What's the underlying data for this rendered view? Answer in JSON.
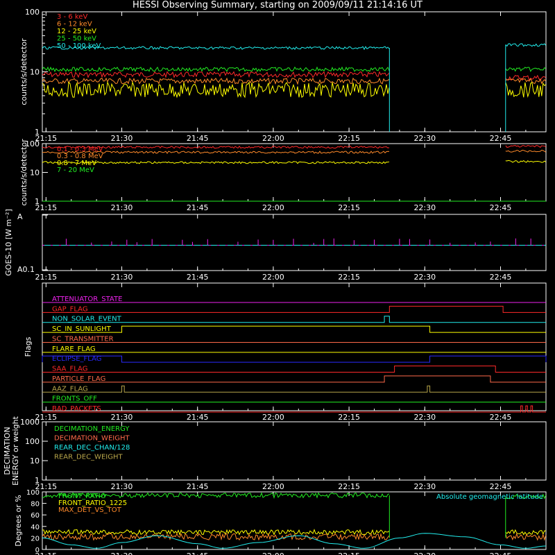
{
  "title": "HESSI Observing Summary, starting on 2009/09/11 21:14:16 UT",
  "colors": {
    "white": "#ffffff",
    "red": "#ff2a2a",
    "orange": "#ff8a2a",
    "yellow": "#ffff00",
    "green": "#22ee22",
    "cyan": "#22eeee",
    "magenta": "#ee22ee",
    "blue": "#2a2aff",
    "olive": "#b8a64a",
    "salmon": "#ff6a4a"
  },
  "time_ticks": [
    "21:15",
    "21:30",
    "21:45",
    "22:00",
    "22:15",
    "22:30",
    "22:45"
  ],
  "time_axis": {
    "start": "21:14:16",
    "end": "22:54:00"
  },
  "chart_data": [
    {
      "id": "panel1",
      "type": "line",
      "ylabel": "counts/s/detector",
      "yscale": "log",
      "ylim": [
        1,
        100
      ],
      "yticks": [
        "1",
        "10",
        "100"
      ],
      "legend_position": "top-left",
      "series": [
        {
          "name": "3 - 6 keV",
          "color": "red",
          "segments": [
            {
              "t0": "21:14:16",
              "t1": "22:23:00",
              "level": 9
            },
            {
              "t0": "22:46:00",
              "t1": "22:54:00",
              "level": 8
            }
          ]
        },
        {
          "name": "6 - 12 keV",
          "color": "orange",
          "segments": [
            {
              "t0": "21:14:16",
              "t1": "22:23:00",
              "level": 7
            },
            {
              "t0": "22:46:00",
              "t1": "22:54:00",
              "level": 7
            }
          ]
        },
        {
          "name": "12 - 25 keV",
          "color": "yellow",
          "segments": [
            {
              "t0": "21:14:16",
              "t1": "22:23:00",
              "level": 5
            },
            {
              "t0": "22:46:00",
              "t1": "22:54:00",
              "level": 5
            }
          ]
        },
        {
          "name": "25 - 50 keV",
          "color": "green",
          "segments": [
            {
              "t0": "21:14:16",
              "t1": "22:23:00",
              "level": 11
            },
            {
              "t0": "22:46:00",
              "t1": "22:54:00",
              "level": 11
            }
          ]
        },
        {
          "name": "50 - 100 keV",
          "color": "cyan",
          "segments": [
            {
              "t0": "21:14:16",
              "t1": "22:23:00",
              "level": 25
            },
            {
              "t0": "22:46:00",
              "t1": "22:54:00",
              "level": 28
            }
          ]
        }
      ]
    },
    {
      "id": "panel2",
      "type": "line",
      "ylabel": "counts/s/detector",
      "yscale": "log",
      "ylim": [
        1,
        100
      ],
      "yticks": [
        "1",
        "10",
        "100"
      ],
      "legend_position": "top-left",
      "series": [
        {
          "name": "0.1 - 0.3 MeV",
          "color": "red",
          "segments": [
            {
              "t0": "21:14:16",
              "t1": "22:23:00",
              "level": 75
            },
            {
              "t0": "22:46:00",
              "t1": "22:54:00",
              "level": 80
            }
          ]
        },
        {
          "name": "0.3 - 0.8 MeV",
          "color": "orange",
          "segments": [
            {
              "t0": "21:14:16",
              "t1": "22:23:00",
              "level": 50
            },
            {
              "t0": "22:46:00",
              "t1": "22:54:00",
              "level": 55
            }
          ]
        },
        {
          "name": "0.8 - 7 MeV",
          "color": "yellow",
          "segments": [
            {
              "t0": "21:14:16",
              "t1": "22:23:00",
              "level": 22
            },
            {
              "t0": "22:46:00",
              "t1": "22:54:00",
              "level": 24
            }
          ]
        },
        {
          "name": "7 - 20 MeV",
          "color": "green",
          "segments": [
            {
              "t0": "21:14:16",
              "t1": "22:54:00",
              "level": 1
            }
          ]
        }
      ]
    },
    {
      "id": "panel3",
      "type": "line",
      "ylabel": "GOES-10 [W m⁻²]",
      "yticks": [
        "A",
        "A0.1"
      ],
      "series": [
        {
          "name": "",
          "color": "magenta",
          "baseline_frac": 0.55,
          "spike_times": [
            "21:19",
            "21:24",
            "21:28",
            "21:31",
            "21:33",
            "21:36",
            "21:42",
            "21:44",
            "21:47",
            "21:53",
            "21:57",
            "22:00",
            "22:04",
            "22:08",
            "22:10",
            "22:12",
            "22:16",
            "22:20",
            "22:25",
            "22:27",
            "22:31",
            "22:35",
            "22:40",
            "22:43",
            "22:48",
            "22:51"
          ]
        }
      ]
    },
    {
      "id": "panel4",
      "type": "line",
      "ylabel": "Flags",
      "flags": [
        {
          "name": "ATTENUATOR_STATE",
          "color": "magenta",
          "on": []
        },
        {
          "name": "GAP_FLAG",
          "color": "red",
          "on": [
            [
              "22:23:00",
              "22:45:30"
            ]
          ]
        },
        {
          "name": "NON_SOLAR_EVENT",
          "color": "cyan",
          "on": [
            [
              "22:22:00",
              "22:23:00"
            ]
          ]
        },
        {
          "name": "SC_IN_SUNLIGHT",
          "color": "yellow",
          "on": [
            [
              "21:30:00",
              "22:31:00"
            ]
          ]
        },
        {
          "name": "SC_TRANSMITTER",
          "color": "salmon",
          "on": []
        },
        {
          "name": "FLARE_FLAG",
          "color": "yellow",
          "on": []
        },
        {
          "name": "ECLIPSE_FLAG",
          "color": "blue",
          "on": [
            [
              "21:14:16",
              "21:30:00"
            ],
            [
              "22:31:00",
              "22:54:00"
            ]
          ]
        },
        {
          "name": "SAA_FLAG",
          "color": "red",
          "on": [
            [
              "22:24:00",
              "22:44:00"
            ]
          ]
        },
        {
          "name": "PARTICLE_FLAG",
          "color": "salmon",
          "on": [
            [
              "22:22:00",
              "22:43:00"
            ]
          ]
        },
        {
          "name": "AAZ_FLAG",
          "color": "olive",
          "on": [
            [
              "21:30:00",
              "21:30:30"
            ],
            [
              "22:30:30",
              "22:31:00"
            ]
          ]
        },
        {
          "name": "FRONTS_OFF",
          "color": "green",
          "on": []
        },
        {
          "name": "BAD_PACKETS",
          "color": "red",
          "on": [
            [
              "22:49:00",
              "22:49:20"
            ],
            [
              "22:50:00",
              "22:50:20"
            ],
            [
              "22:51:00",
              "22:51:20"
            ]
          ]
        }
      ]
    },
    {
      "id": "panel5",
      "type": "line",
      "ylabel": "DECIMATION ENERGY or weight",
      "yscale": "log",
      "ylim": [
        1,
        1000
      ],
      "yticks": [
        "1",
        "10",
        "100",
        "1000"
      ],
      "legend_position": "top-left",
      "series": [
        {
          "name": "DECIMATION_ENERGY",
          "color": "green",
          "values": []
        },
        {
          "name": "DECIMATION_WEIGHT",
          "color": "salmon",
          "values": []
        },
        {
          "name": "REAR_DEC_CHAN/128",
          "color": "cyan",
          "values": []
        },
        {
          "name": "REAR_DEC_WEIGHT",
          "color": "olive",
          "values": []
        }
      ]
    },
    {
      "id": "panel6",
      "type": "line",
      "ylabel": "Degrees or %",
      "ylim": [
        0,
        100
      ],
      "yticks": [
        "0",
        "20",
        "40",
        "60",
        "80",
        "100"
      ],
      "legend_position": "top-left",
      "annotation": "Absolute geomagnetic latitude",
      "series": [
        {
          "name": "FRONT_RATIO",
          "color": "green",
          "segments": [
            {
              "t0": "21:14:16",
              "t1": "22:23:00",
              "level": 94
            },
            {
              "t0": "22:46:00",
              "t1": "22:54:00",
              "level": 92
            }
          ]
        },
        {
          "name": "FRONT_RATIO_1225",
          "color": "yellow",
          "segments": [
            {
              "t0": "21:14:16",
              "t1": "22:23:00",
              "level": 30
            },
            {
              "t0": "22:46:00",
              "t1": "22:54:00",
              "level": 30
            }
          ]
        },
        {
          "name": "MAX_DET_VS_TOT",
          "color": "orange",
          "segments": [
            {
              "t0": "21:14:16",
              "t1": "22:23:00",
              "level": 22
            },
            {
              "t0": "22:46:00",
              "t1": "22:54:00",
              "level": 22
            }
          ]
        },
        {
          "name": "",
          "color": "cyan",
          "points": [
            [
              "21:14:16",
              20
            ],
            [
              "21:20",
              8
            ],
            [
              "21:25",
              2
            ],
            [
              "21:30",
              12
            ],
            [
              "21:37",
              24
            ],
            [
              "21:45",
              10
            ],
            [
              "21:50",
              2
            ],
            [
              "21:57",
              12
            ],
            [
              "22:05",
              24
            ],
            [
              "22:12",
              10
            ],
            [
              "22:18",
              2
            ],
            [
              "22:25",
              20
            ],
            [
              "22:30",
              28
            ],
            [
              "22:38",
              22
            ],
            [
              "22:45",
              8
            ],
            [
              "22:50",
              2
            ],
            [
              "22:54",
              6
            ]
          ]
        }
      ]
    }
  ]
}
